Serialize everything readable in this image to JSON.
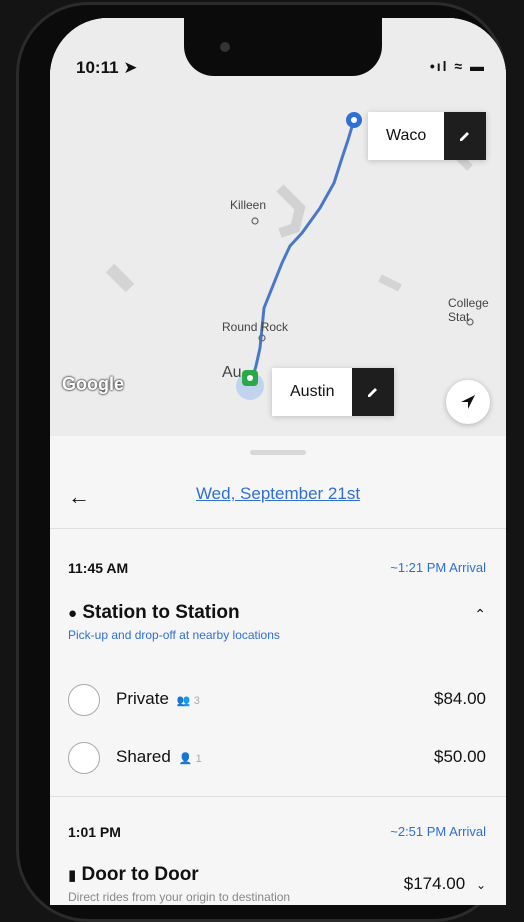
{
  "status": {
    "time": "10:11 ➤",
    "icons": "•ıl ≈ ▬"
  },
  "map": {
    "origin_label": "Austin",
    "destination_label": "Waco",
    "places": [
      "Killeen",
      "Round Rock",
      "College Stat",
      "Au"
    ],
    "google_logo": "Google"
  },
  "header": {
    "date": "Wed, September 21st"
  },
  "trips": [
    {
      "depart": "11:45 AM",
      "arrival": "~1:21 PM Arrival",
      "title": "Station to Station",
      "subtitle": "Pick-up and drop-off at nearby locations",
      "options": [
        {
          "name": "Private",
          "capacity": "3",
          "price": "$84.00"
        },
        {
          "name": "Shared",
          "capacity": "1",
          "price": "$50.00"
        }
      ]
    },
    {
      "depart": "1:01 PM",
      "arrival": "~2:51 PM Arrival",
      "title": "Door to Door",
      "subtitle": "Direct rides from your origin to destination",
      "price": "$174.00"
    }
  ],
  "colors": {
    "accent": "#2f6fd6",
    "dark": "#1e1e1e",
    "route": "#4a78c8"
  }
}
